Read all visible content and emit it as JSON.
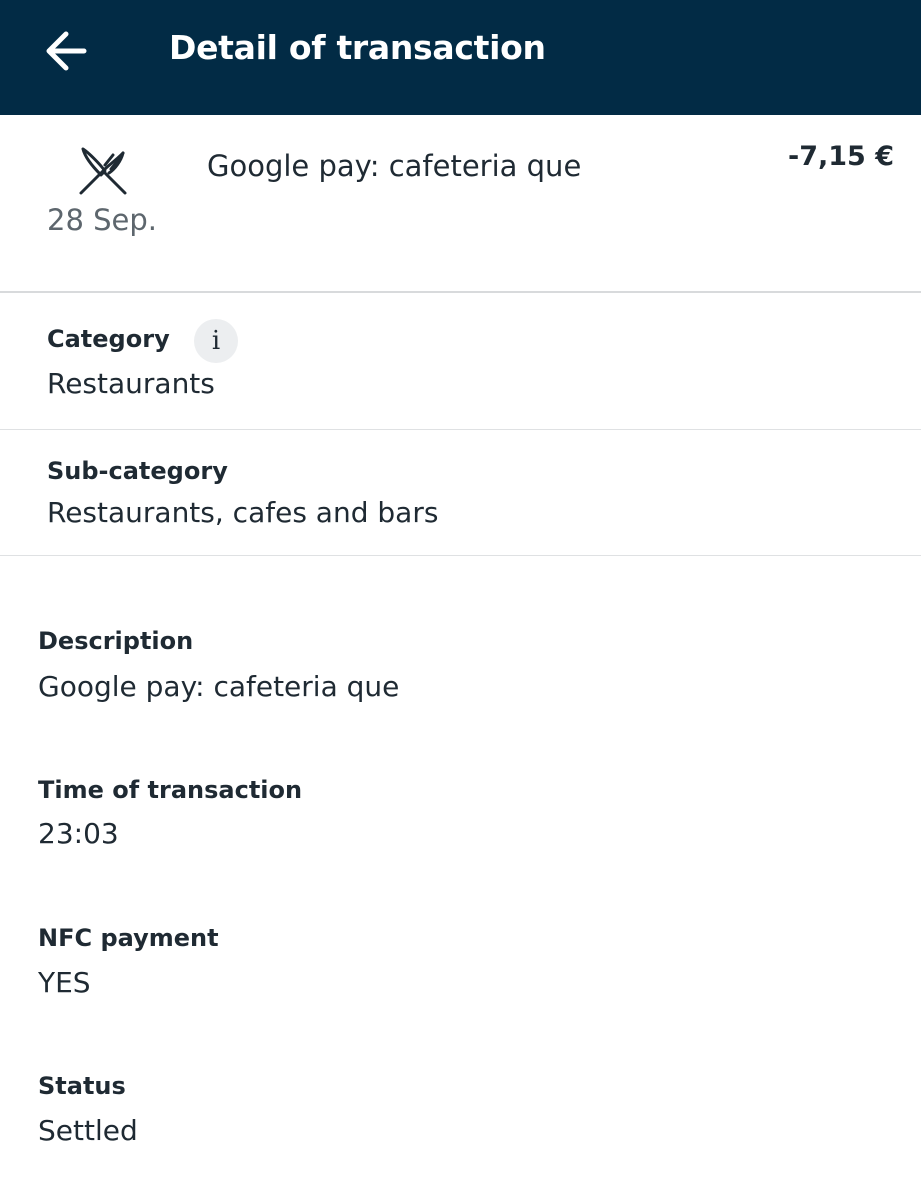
{
  "header": {
    "title": "Detail of transaction",
    "back_icon": "arrow-left-icon",
    "background_color": "#022b45"
  },
  "transaction": {
    "icon": "fork-knife-icon",
    "date": "28 Sep.",
    "merchant": "Google pay: cafeteria que",
    "amount": "-7,15 €"
  },
  "category": {
    "label": "Category",
    "info_icon": "info-icon",
    "info_glyph": "i",
    "value": "Restaurants"
  },
  "subcategory": {
    "label": "Sub-category",
    "value": "Restaurants, cafes and bars"
  },
  "details": {
    "description": {
      "label": "Description",
      "value": "Google pay: cafeteria que"
    },
    "time": {
      "label": "Time of transaction",
      "value": "23:03"
    },
    "nfc": {
      "label": "NFC payment",
      "value": "YES"
    },
    "status": {
      "label": "Status",
      "value": "Settled"
    }
  }
}
